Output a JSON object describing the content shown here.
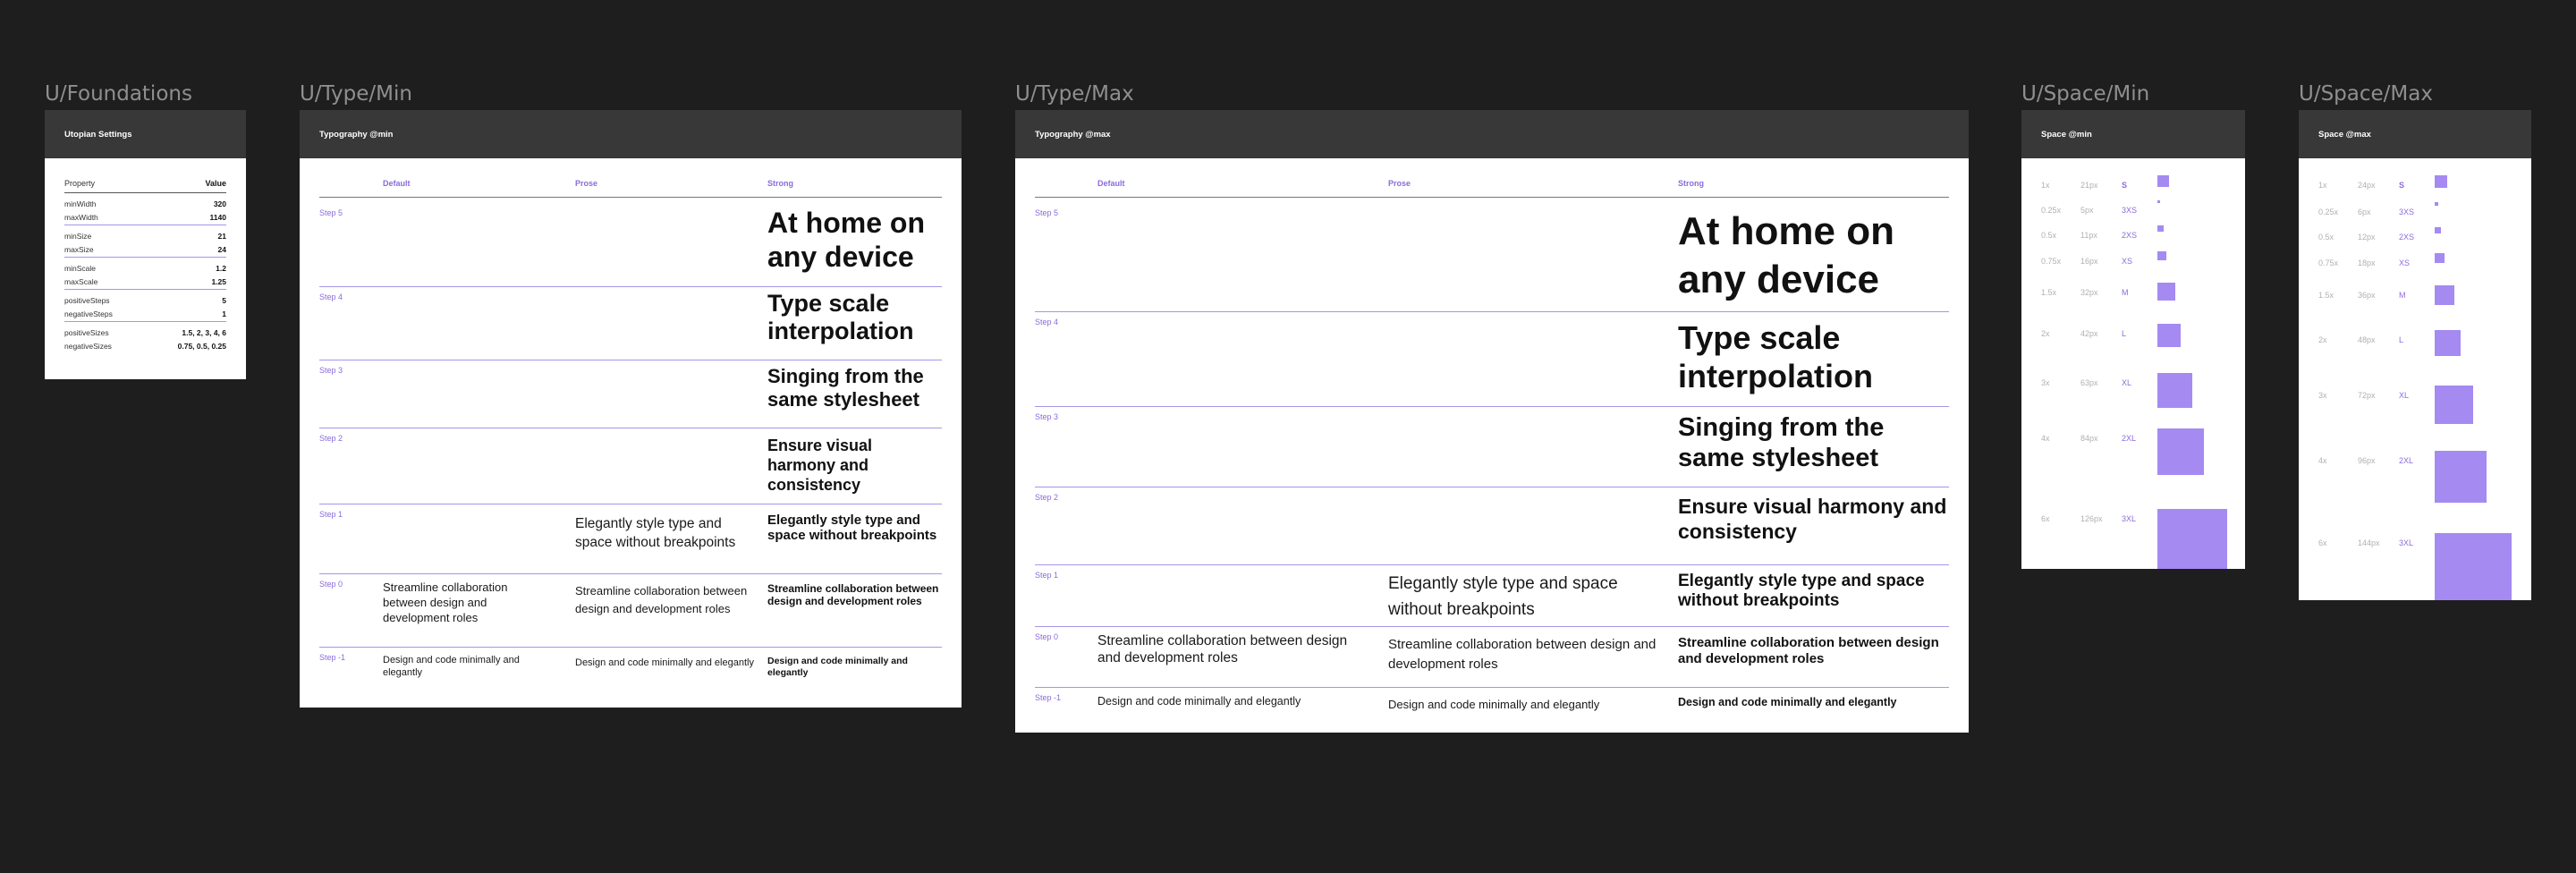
{
  "labels": {
    "foundations": "U/Foundations",
    "type_min": "U/Type/Min",
    "type_max": "U/Type/Max",
    "space_min": "U/Space/Min",
    "space_max": "U/Space/Max"
  },
  "foundations": {
    "title": "Utopian Settings",
    "col_property": "Property",
    "col_value": "Value",
    "rows": [
      {
        "k": "minWidth",
        "v": "320"
      },
      {
        "k": "maxWidth",
        "v": "1140"
      },
      {
        "k": "minSize",
        "v": "21"
      },
      {
        "k": "maxSize",
        "v": "24"
      },
      {
        "k": "minScale",
        "v": "1.2"
      },
      {
        "k": "maxScale",
        "v": "1.25"
      },
      {
        "k": "positiveSteps",
        "v": "5"
      },
      {
        "k": "negativeSteps",
        "v": "1"
      },
      {
        "k": "positiveSizes",
        "v": "1.5, 2, 3, 4, 6"
      },
      {
        "k": "negativeSizes",
        "v": "0.75, 0.5, 0.25"
      }
    ]
  },
  "type_min": {
    "title": "Typography @min",
    "col_default": "Default",
    "col_prose": "Prose",
    "col_strong": "Strong",
    "steps": [
      {
        "label": "Step 5",
        "strong": "At home on any device"
      },
      {
        "label": "Step 4",
        "strong": "Type scale interpolation"
      },
      {
        "label": "Step 3",
        "strong": "Singing from the same stylesheet"
      },
      {
        "label": "Step 2",
        "strong": "Ensure visual harmony and consistency"
      },
      {
        "label": "Step 1",
        "prose": "Elegantly style type and space without breakpoints",
        "strong": "Elegantly style type and space without breakpoints"
      },
      {
        "label": "Step 0",
        "default": "Streamline collaboration between design and development roles",
        "prose": "Streamline collaboration between design and development roles",
        "strong": "Streamline collaboration between design and development roles"
      },
      {
        "label": "Step -1",
        "default": "Design and code minimally and elegantly",
        "prose": "Design and code minimally and elegantly",
        "strong": "Design and code minimally and elegantly"
      }
    ]
  },
  "type_max": {
    "title": "Typography @max",
    "col_default": "Default",
    "col_prose": "Prose",
    "col_strong": "Strong",
    "steps": [
      {
        "label": "Step 5",
        "strong": "At home on any device"
      },
      {
        "label": "Step 4",
        "strong": "Type scale interpolation"
      },
      {
        "label": "Step 3",
        "strong": "Singing from the same stylesheet"
      },
      {
        "label": "Step 2",
        "strong": "Ensure visual harmony and consistency"
      },
      {
        "label": "Step 1",
        "prose": "Elegantly style type and space without breakpoints",
        "strong": "Elegantly style type and space without breakpoints"
      },
      {
        "label": "Step 0",
        "default": "Streamline collaboration between design and development roles",
        "prose": "Streamline collaboration between design and development roles",
        "strong": "Streamline collaboration between design and development roles"
      },
      {
        "label": "Step -1",
        "default": "Design and code minimally and elegantly",
        "prose": "Design and code minimally and elegantly",
        "strong": "Design and code minimally and elegantly"
      }
    ]
  },
  "space_min": {
    "title": "Space @min",
    "rows": [
      {
        "mult": "1x",
        "px": "21px",
        "name": "S"
      },
      {
        "mult": "0.25x",
        "px": "5px",
        "name": "3XS"
      },
      {
        "mult": "0.5x",
        "px": "11px",
        "name": "2XS"
      },
      {
        "mult": "0.75x",
        "px": "16px",
        "name": "XS"
      },
      {
        "mult": "1.5x",
        "px": "32px",
        "name": "M"
      },
      {
        "mult": "2x",
        "px": "42px",
        "name": "L"
      },
      {
        "mult": "3x",
        "px": "63px",
        "name": "XL"
      },
      {
        "mult": "4x",
        "px": "84px",
        "name": "2XL"
      },
      {
        "mult": "6x",
        "px": "126px",
        "name": "3XL"
      }
    ]
  },
  "space_max": {
    "title": "Space @max",
    "rows": [
      {
        "mult": "1x",
        "px": "24px",
        "name": "S"
      },
      {
        "mult": "0.25x",
        "px": "6px",
        "name": "3XS"
      },
      {
        "mult": "0.5x",
        "px": "12px",
        "name": "2XS"
      },
      {
        "mult": "0.75x",
        "px": "18px",
        "name": "XS"
      },
      {
        "mult": "1.5x",
        "px": "36px",
        "name": "M"
      },
      {
        "mult": "2x",
        "px": "48px",
        "name": "L"
      },
      {
        "mult": "3x",
        "px": "72px",
        "name": "XL"
      },
      {
        "mult": "4x",
        "px": "96px",
        "name": "2XL"
      },
      {
        "mult": "6x",
        "px": "144px",
        "name": "3XL"
      }
    ]
  },
  "colors": {
    "canvas": "#1e1e1e",
    "header": "#383838",
    "accent": "#8b6bdc",
    "swatch": "#a58af2"
  }
}
